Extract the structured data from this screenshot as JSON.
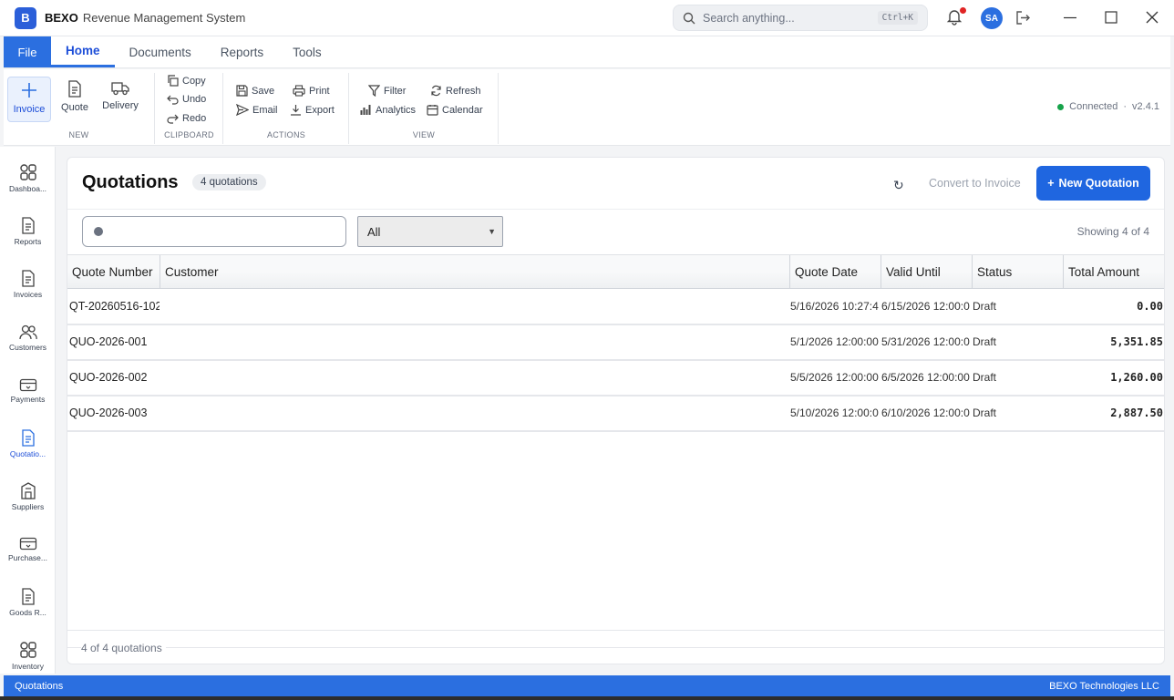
{
  "app": {
    "logo_letter": "B",
    "brand": "BEXO",
    "subtitle": "Revenue Management System",
    "search_placeholder": "Search anything...",
    "search_shortcut": "Ctrl+K",
    "user_initials": "SA"
  },
  "ribbon": {
    "file_label": "File",
    "tabs": [
      "Home",
      "Documents",
      "Reports",
      "Tools"
    ],
    "active_tab": "Home",
    "groups": {
      "new": {
        "label": "NEW",
        "items": [
          "Invoice",
          "Quote",
          "Delivery"
        ]
      },
      "clipboard": {
        "label": "CLIPBOARD",
        "items": [
          "Copy",
          "Undo",
          "Redo"
        ]
      },
      "actions": {
        "label": "ACTIONS",
        "items": [
          "Save",
          "Print",
          "Email",
          "Export"
        ]
      },
      "view": {
        "label": "VIEW",
        "items": [
          "Filter",
          "Refresh",
          "Analytics",
          "Calendar"
        ]
      }
    },
    "connection_status": "Connected",
    "version": "v2.4.1"
  },
  "sidebar": {
    "items": [
      {
        "label": "Dashboa...",
        "icon": "dashboard-icon"
      },
      {
        "label": "Reports",
        "icon": "document-icon"
      },
      {
        "label": "Invoices",
        "icon": "document-icon"
      },
      {
        "label": "Customers",
        "icon": "users-icon"
      },
      {
        "label": "Payments",
        "icon": "card-icon"
      },
      {
        "label": "Quotatio...",
        "icon": "document-icon",
        "active": true
      },
      {
        "label": "Suppliers",
        "icon": "building-icon"
      },
      {
        "label": "Purchase...",
        "icon": "card-icon"
      },
      {
        "label": "Goods R...",
        "icon": "document-icon"
      },
      {
        "label": "Inventory",
        "icon": "dashboard-icon"
      }
    ]
  },
  "main": {
    "title": "Quotations",
    "count_badge": "4 quotations",
    "convert_label": "Convert to Invoice",
    "new_label": "New Quotation",
    "search_value": "",
    "status_filter": "All",
    "showing": "Showing 4 of 4",
    "columns": [
      "Quote Number",
      "Customer",
      "Quote Date",
      "Valid Until",
      "Status",
      "Total Amount"
    ],
    "rows": [
      [
        "QT-20260516-102",
        "",
        "5/16/2026 10:27:4",
        "6/15/2026 12:00:0",
        "Draft",
        "0.00"
      ],
      [
        "QUO-2026-001",
        "",
        "5/1/2026 12:00:00",
        "5/31/2026 12:00:0",
        "Draft",
        "5,351.85"
      ],
      [
        "QUO-2026-002",
        "",
        "5/5/2026 12:00:00",
        "6/5/2026 12:00:00",
        "Draft",
        "1,260.00"
      ],
      [
        "QUO-2026-003",
        "",
        "5/10/2026 12:00:0",
        "6/10/2026 12:00:0",
        "Draft",
        "2,887.50"
      ]
    ],
    "footer": "4 of 4 quotations"
  },
  "statusbar": {
    "left": "Quotations",
    "right": "BEXO Technologies LLC"
  },
  "colors": {
    "accent": "#2b6fe0",
    "connected": "#16a34a",
    "notification": "#e02424"
  }
}
